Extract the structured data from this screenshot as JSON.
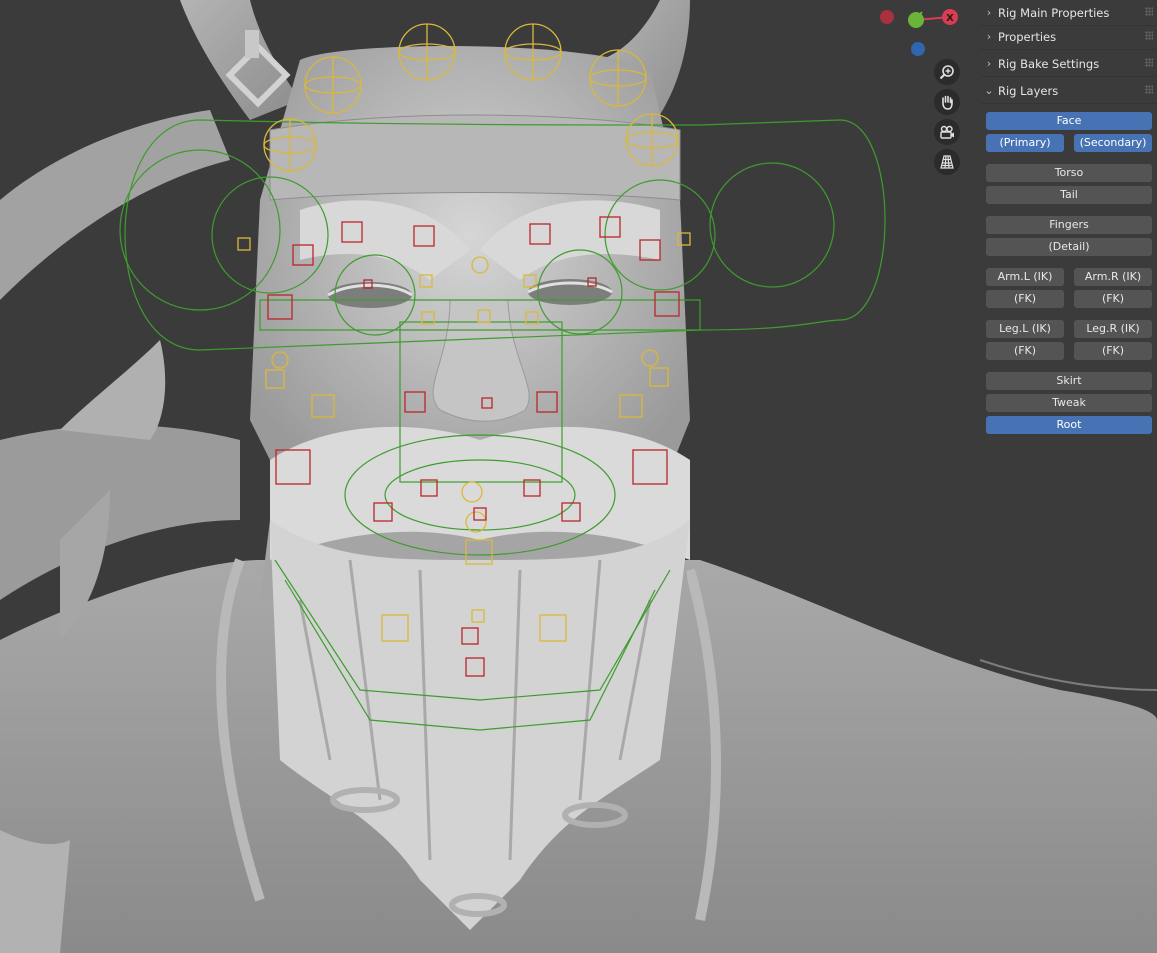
{
  "gizmo": {
    "x_axis_label": "X",
    "x_color": "#d93d50",
    "y_color": "#6ab43a",
    "z_color": "#3a7dd1",
    "neg_x_color": "#a8313f",
    "neg_z_color": "#2f66ad"
  },
  "viewport_tools": [
    {
      "icon": "zoom-in-icon"
    },
    {
      "icon": "hand-pan-icon"
    },
    {
      "icon": "camera-view-icon"
    },
    {
      "icon": "grid-ortho-icon"
    }
  ],
  "rig_colors": {
    "ik_widget": "#d9b93a",
    "face_widget": "#b8262a",
    "tweak_widget": "#3e9c2e",
    "mesh_light": "#cfcfcf",
    "mesh_dark": "#8f8f8f"
  },
  "sidebar": {
    "panels": [
      {
        "title": "Rig Main Properties",
        "expanded": false
      },
      {
        "title": "Properties",
        "expanded": false
      },
      {
        "title": "Rig Bake Settings",
        "expanded": false
      },
      {
        "title": "Rig Layers",
        "expanded": true
      }
    ],
    "layers": {
      "face": {
        "label": "Face",
        "on": true
      },
      "primary": {
        "label": "(Primary)",
        "on": true
      },
      "secondary": {
        "label": "(Secondary)",
        "on": true
      },
      "torso": {
        "label": "Torso",
        "on": false
      },
      "tail": {
        "label": "Tail",
        "on": false
      },
      "fingers": {
        "label": "Fingers",
        "on": false
      },
      "detail": {
        "label": "(Detail)",
        "on": false
      },
      "arm_l_ik": {
        "label": "Arm.L (IK)",
        "on": false
      },
      "arm_r_ik": {
        "label": "Arm.R (IK)",
        "on": false
      },
      "arm_l_fk": {
        "label": "(FK)",
        "on": false
      },
      "arm_r_fk": {
        "label": "(FK)",
        "on": false
      },
      "leg_l_ik": {
        "label": "Leg.L (IK)",
        "on": false
      },
      "leg_r_ik": {
        "label": "Leg.R (IK)",
        "on": false
      },
      "leg_l_fk": {
        "label": "(FK)",
        "on": false
      },
      "leg_r_fk": {
        "label": "(FK)",
        "on": false
      },
      "skirt": {
        "label": "Skirt",
        "on": false
      },
      "tweak": {
        "label": "Tweak",
        "on": false
      },
      "root": {
        "label": "Root",
        "on": true
      }
    }
  }
}
